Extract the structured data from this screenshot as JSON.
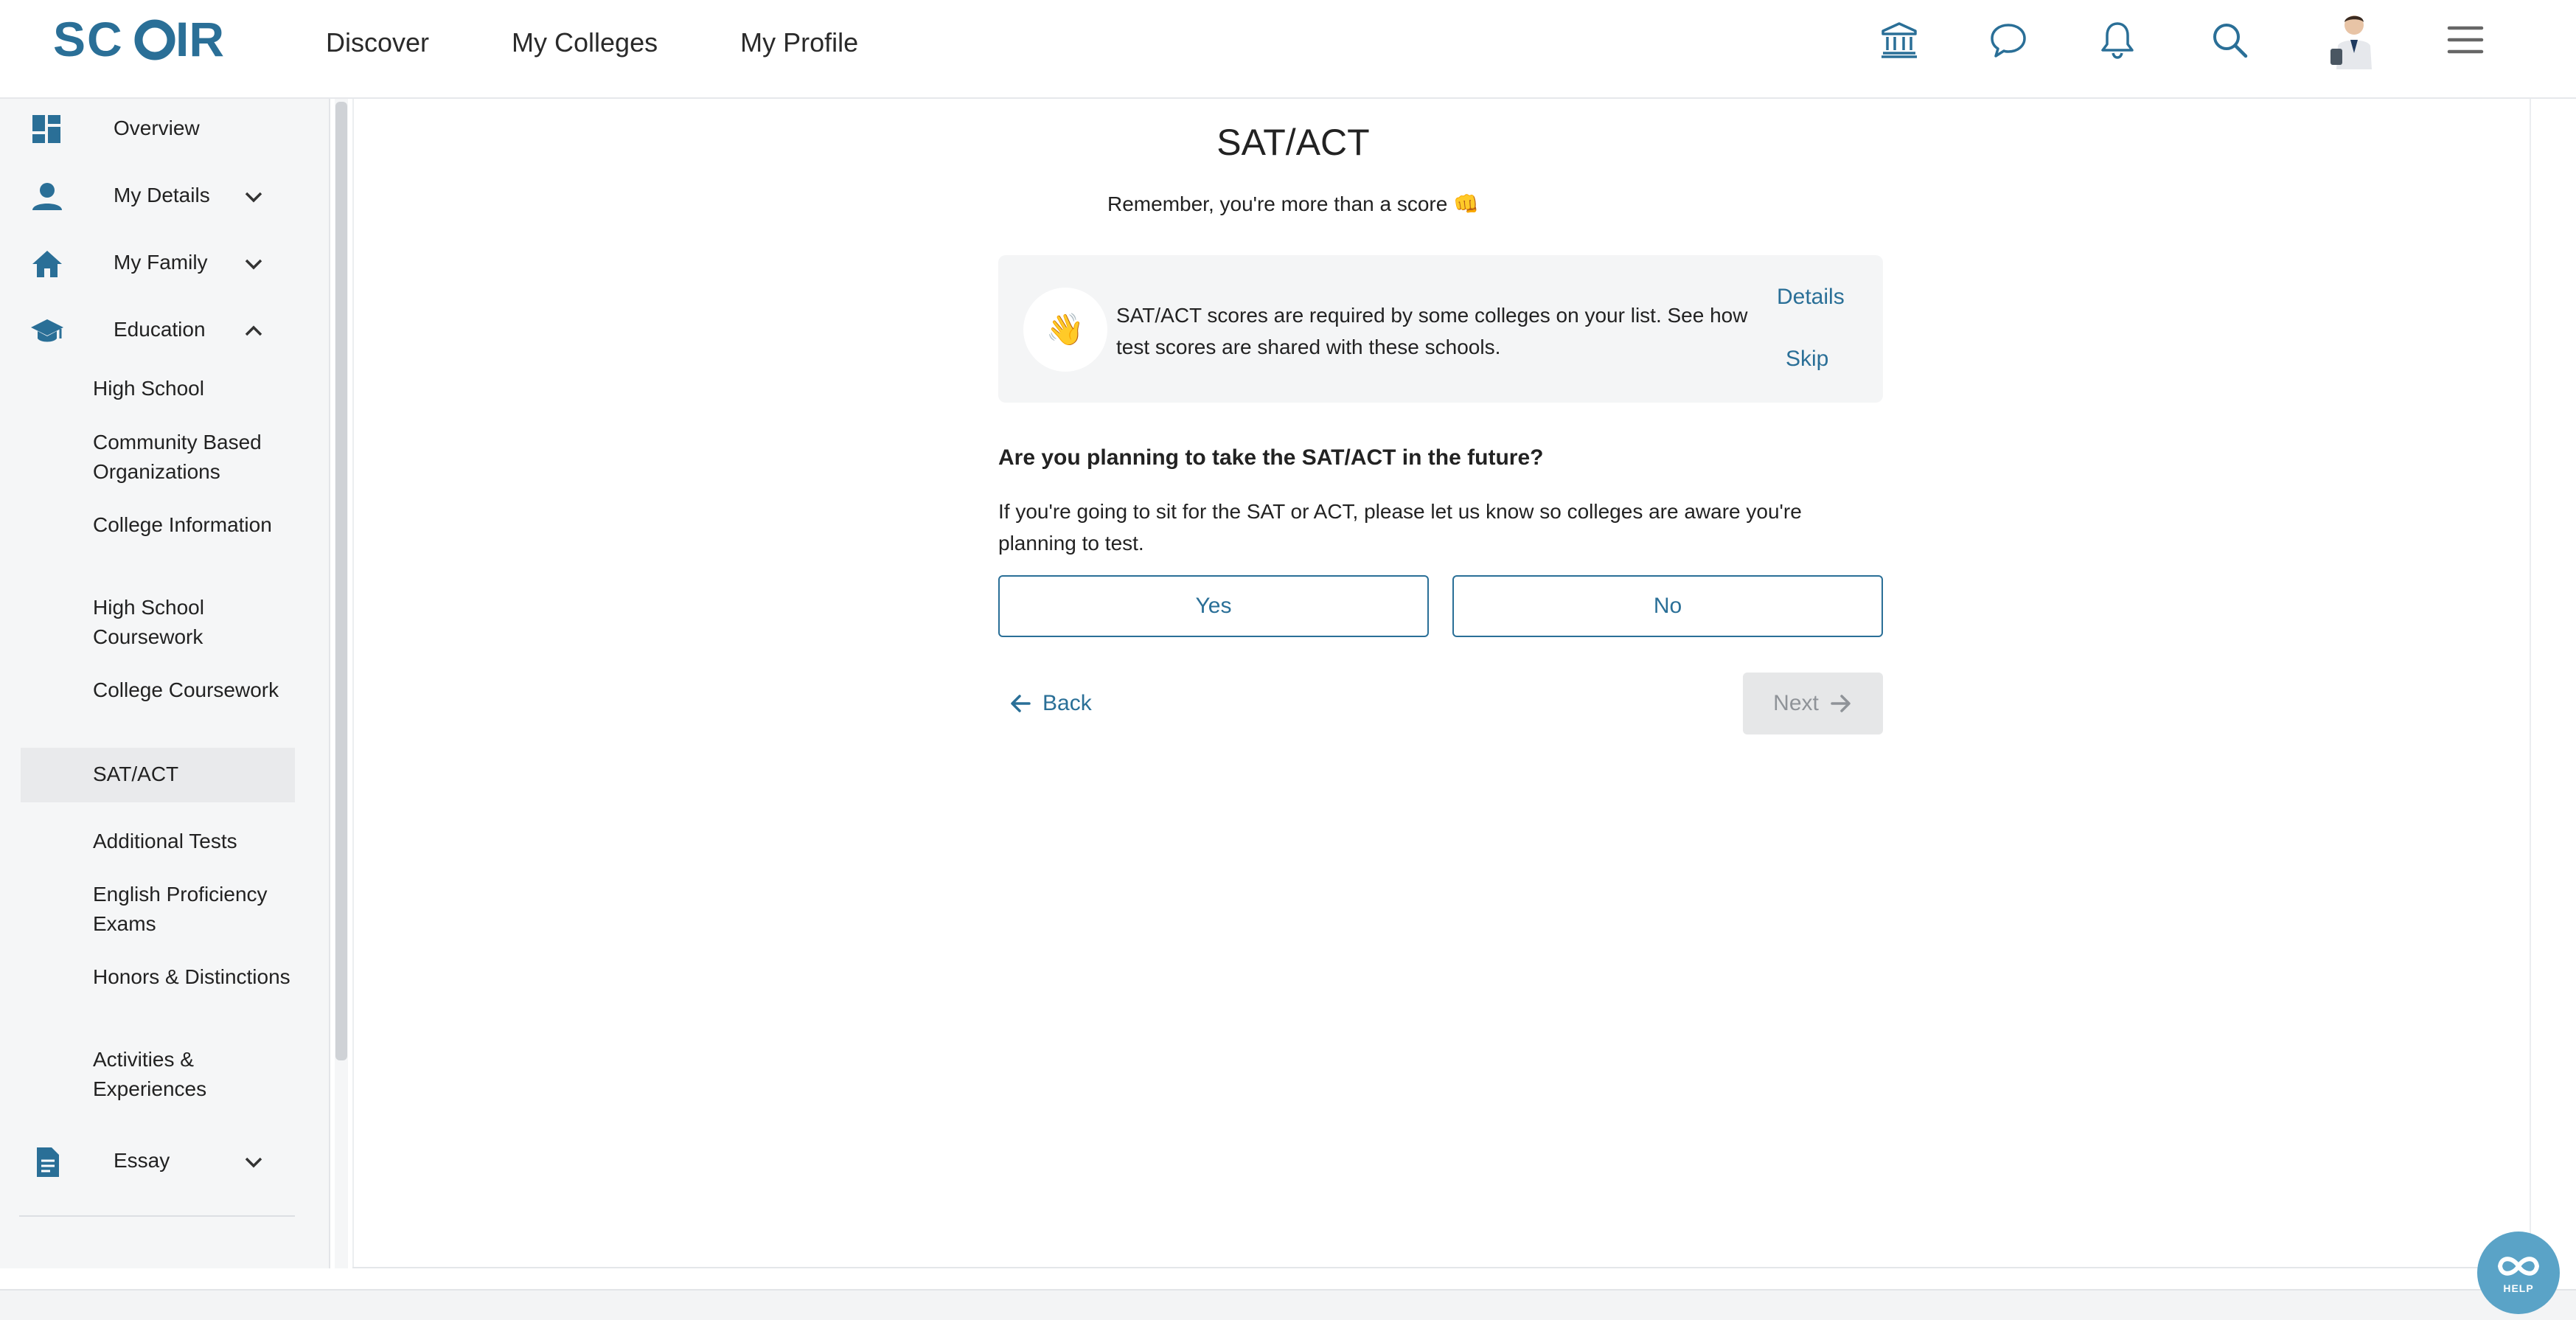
{
  "brand": {
    "logo": "SCOIR",
    "color": "#2a6f97"
  },
  "nav": {
    "links": [
      "Discover",
      "My Colleges",
      "My Profile"
    ],
    "icons": [
      "institution-icon",
      "chat-icon",
      "bell-icon",
      "search-icon",
      "avatar",
      "menu-icon"
    ]
  },
  "sidebar": {
    "sections": {
      "overview": "Overview",
      "my_details": "My Details",
      "my_family": "My Family",
      "education": "Education",
      "essay": "Essay"
    },
    "education_items": [
      "High School",
      "Community Based Organizations",
      "College Information",
      "High School Coursework",
      "College Coursework",
      "SAT/ACT",
      "Additional Tests",
      "English Proficiency Exams",
      "Honors & Distinctions",
      "Activities & Experiences"
    ],
    "active_item": "SAT/ACT"
  },
  "main": {
    "title": "SAT/ACT",
    "subtitle": "Remember, you're more than a score 👊",
    "info": {
      "emoji": "👋",
      "text": "SAT/ACT scores are required by some colleges on your list. See how test scores are shared with these schools.",
      "details_link": "Details",
      "skip_link": "Skip"
    },
    "question": "Are you planning to take the SAT/ACT in the future?",
    "question_help": "If you're going to sit for the SAT or ACT, please let us know so colleges are aware you're planning to test.",
    "yes_label": "Yes",
    "no_label": "No",
    "back_label": "Back",
    "next_label": "Next"
  },
  "help": {
    "label": "HELP"
  },
  "colors": {
    "accent": "#2a6f97",
    "help_bubble": "#5aa3c7",
    "disabled": "#8f9398"
  }
}
